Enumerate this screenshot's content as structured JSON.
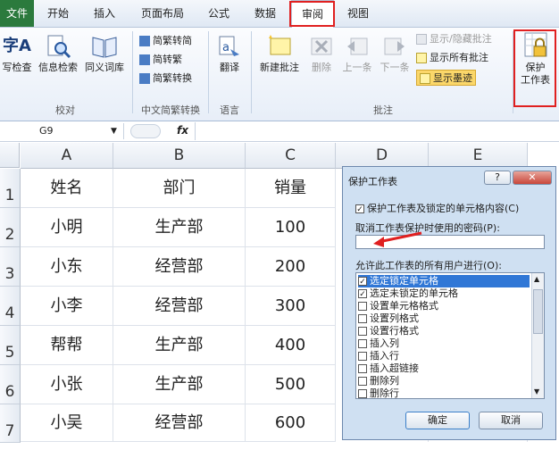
{
  "tabs": [
    "文件",
    "开始",
    "插入",
    "页面布局",
    "公式",
    "数据",
    "审阅",
    "视图"
  ],
  "ribbon": {
    "proofing": {
      "spell_char": "字A",
      "spell": "写检查",
      "research": "信息检索",
      "thesaurus": "同义词库",
      "group": "校对"
    },
    "chinese": {
      "trad_to_simp": "简繁转简",
      "simp_to_trad": "简转繁",
      "convert": "简繁转换",
      "group": "中文简繁转换"
    },
    "language": {
      "translate": "翻译",
      "group": "语言"
    },
    "comments": {
      "new": "新建批注",
      "delete": "删除",
      "prev": "上一条",
      "next": "下一条",
      "show_hide": "显示/隐藏批注",
      "show_all": "显示所有批注",
      "show_ink": "显示墨迹",
      "group": "批注"
    },
    "changes": {
      "protect_sheet_line1": "保护",
      "protect_sheet_line2": "工作表"
    }
  },
  "namebox": {
    "value": "G9"
  },
  "formula_fx": "fx",
  "columns": [
    "A",
    "B",
    "C",
    "D",
    "E"
  ],
  "rows": [
    "1",
    "2",
    "3",
    "4",
    "5",
    "6",
    "7"
  ],
  "cells": [
    [
      "姓名",
      "部门",
      "销量"
    ],
    [
      "小明",
      "生产部",
      "100"
    ],
    [
      "小东",
      "经营部",
      "200"
    ],
    [
      "小李",
      "经营部",
      "300"
    ],
    [
      "帮帮",
      "生产部",
      "400"
    ],
    [
      "小张",
      "生产部",
      "500"
    ],
    [
      "小吴",
      "经营部",
      "600"
    ]
  ],
  "dialog": {
    "title": "保护工作表",
    "help": "?",
    "protect_label": "保护工作表及锁定的单元格内容(C)",
    "password_label": "取消工作表保护时使用的密码(P):",
    "password_value": "",
    "allow_label": "允许此工作表的所有用户进行(O):",
    "check_mark": "✓",
    "permissions": [
      {
        "label": "选定锁定单元格",
        "checked": true,
        "selected": true
      },
      {
        "label": "选定未锁定的单元格",
        "checked": true,
        "selected": false
      },
      {
        "label": "设置单元格格式",
        "checked": false,
        "selected": false
      },
      {
        "label": "设置列格式",
        "checked": false,
        "selected": false
      },
      {
        "label": "设置行格式",
        "checked": false,
        "selected": false
      },
      {
        "label": "插入列",
        "checked": false,
        "selected": false
      },
      {
        "label": "插入行",
        "checked": false,
        "selected": false
      },
      {
        "label": "插入超链接",
        "checked": false,
        "selected": false
      },
      {
        "label": "删除列",
        "checked": false,
        "selected": false
      },
      {
        "label": "删除行",
        "checked": false,
        "selected": false
      }
    ],
    "ok": "确定",
    "cancel": "取消"
  },
  "colors": {
    "highlight_red": "#e02020",
    "file_tab": "#2b7a3d",
    "selection": "#3077d6"
  }
}
